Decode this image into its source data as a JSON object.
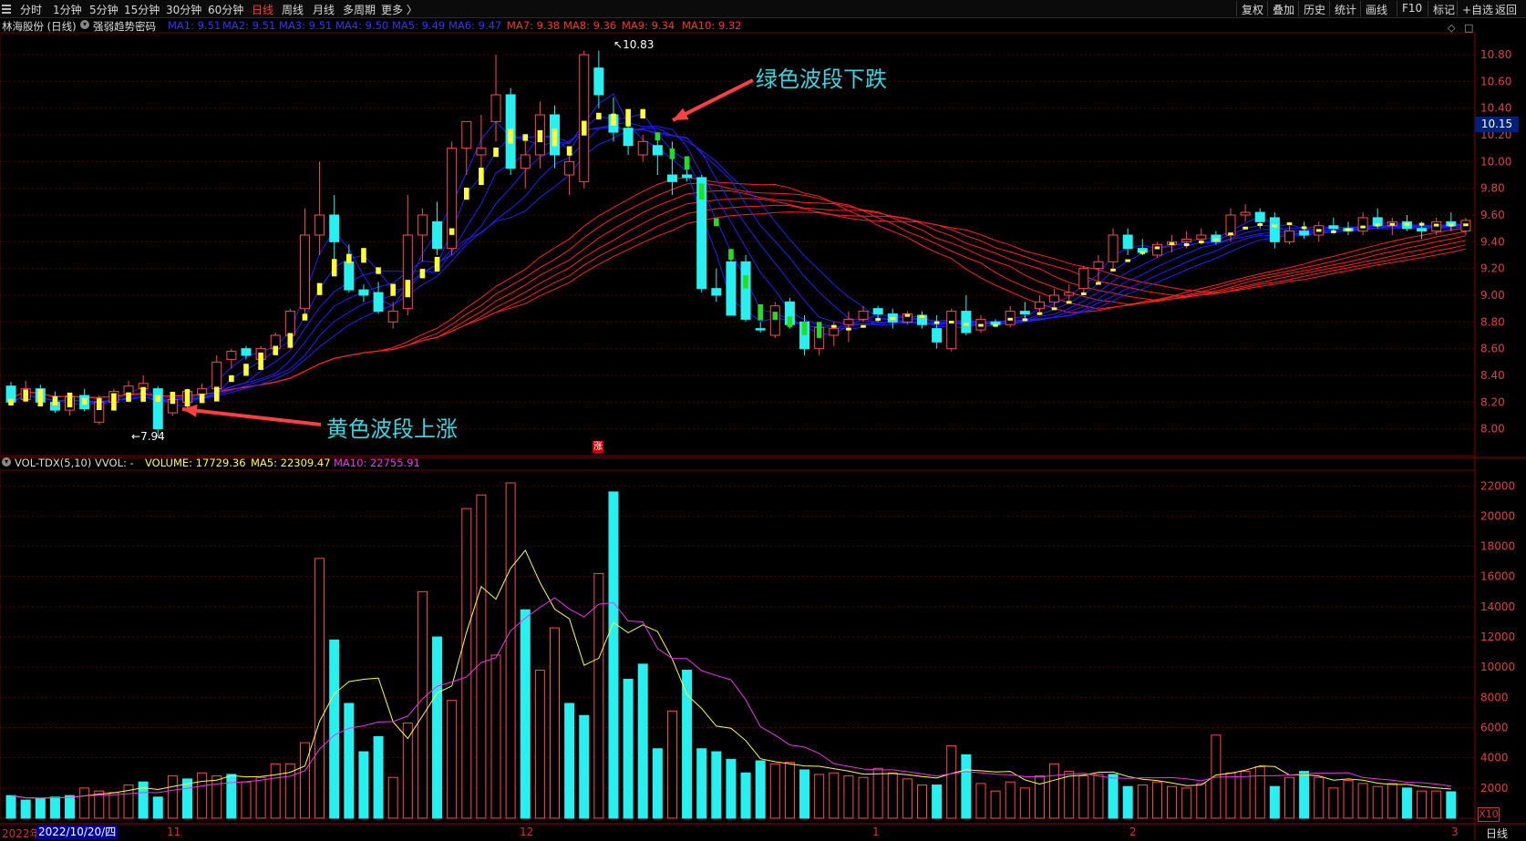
{
  "toolbar": {
    "timeframes": [
      "分时",
      "1分钟",
      "5分钟",
      "15分钟",
      "30分钟",
      "60分钟",
      "日线",
      "周线",
      "月线",
      "多周期",
      "更多 〉"
    ],
    "active_index": 6,
    "right_buttons": [
      "复权",
      "叠加",
      "历史",
      "统计",
      "画线",
      "F10",
      "标记",
      "+自选",
      "返回"
    ]
  },
  "info": {
    "stock": "林海股份 (日线)",
    "indicator": "强弱趋势密码",
    "ma_short": [
      "MA1: 9.51",
      "MA2: 9.51",
      "MA3: 9.51",
      "MA4: 9.50",
      "MA5: 9.49",
      "MA6: 9.47"
    ],
    "ma_long": [
      "MA7: 9.38",
      "MA8: 9.36",
      "MA9: 9.34",
      "MA10: 9.32"
    ]
  },
  "volume_info": {
    "label": "VOL-TDX(5,10) VVOL: -",
    "volume": "VOLUME: 17729.36",
    "ma5": "MA5: 22309.47",
    "ma10": "MA10: 22755.91"
  },
  "annotations": {
    "green_wave": "绿色波段下跌",
    "yellow_wave": "黄色波段上涨",
    "high_tag": "10.83",
    "low_tag": "7.94",
    "current_price": "10.15",
    "zhang_badge": "涨"
  },
  "xaxis": {
    "year": "2022年",
    "date_box": "2022/10/20/四",
    "months": [
      "11",
      "12",
      "1",
      "2",
      "3"
    ],
    "period_label": "日线",
    "x10": "X10"
  },
  "colors": {
    "up_candle": "#ff4a4a",
    "down_candle": "#29f0f0",
    "yellow_signal": "#ffff33",
    "green_signal": "#22dd22",
    "short_ma": "#2020ff",
    "long_ma": "#ff2020",
    "vol_ma5": "#ffff33",
    "vol_ma10": "#ee33ee"
  },
  "chart_data": [
    {
      "type": "candlestick",
      "title": "林海股份 (日线)",
      "ylim": [
        7.8,
        10.95
      ],
      "yticks": [
        8.0,
        8.2,
        8.4,
        8.6,
        8.8,
        9.0,
        9.2,
        9.4,
        9.6,
        9.8,
        10.0,
        10.2,
        10.4,
        10.6,
        10.8
      ],
      "ohlc": [
        [
          8.32,
          8.35,
          8.18,
          8.2
        ],
        [
          8.22,
          8.36,
          8.2,
          8.3
        ],
        [
          8.3,
          8.33,
          8.18,
          8.2
        ],
        [
          8.2,
          8.28,
          8.12,
          8.14
        ],
        [
          8.14,
          8.26,
          8.1,
          8.24
        ],
        [
          8.25,
          8.3,
          8.13,
          8.15
        ],
        [
          8.05,
          8.25,
          8.03,
          8.2
        ],
        [
          8.2,
          8.3,
          8.16,
          8.28
        ],
        [
          8.26,
          8.36,
          8.2,
          8.32
        ],
        [
          8.3,
          8.4,
          8.24,
          8.34
        ],
        [
          8.3,
          8.32,
          7.94,
          8.0
        ],
        [
          8.12,
          8.24,
          8.1,
          8.22
        ],
        [
          8.2,
          8.3,
          8.15,
          8.28
        ],
        [
          8.26,
          8.34,
          8.2,
          8.3
        ],
        [
          8.3,
          8.55,
          8.25,
          8.5
        ],
        [
          8.52,
          8.6,
          8.45,
          8.58
        ],
        [
          8.6,
          8.62,
          8.52,
          8.55
        ],
        [
          8.52,
          8.62,
          8.45,
          8.6
        ],
        [
          8.6,
          8.72,
          8.58,
          8.7
        ],
        [
          8.7,
          8.9,
          8.6,
          8.88
        ],
        [
          8.9,
          9.65,
          8.85,
          9.45
        ],
        [
          9.45,
          10.0,
          9.3,
          9.6
        ],
        [
          9.6,
          9.75,
          9.2,
          9.4
        ],
        [
          9.25,
          9.38,
          9.02,
          9.04
        ],
        [
          9.04,
          9.08,
          8.95,
          9.0
        ],
        [
          9.02,
          9.1,
          8.86,
          8.88
        ],
        [
          8.8,
          8.95,
          8.75,
          8.88
        ],
        [
          8.9,
          9.75,
          8.85,
          9.45
        ],
        [
          9.45,
          9.65,
          9.25,
          9.6
        ],
        [
          9.55,
          9.7,
          9.3,
          9.35
        ],
        [
          9.35,
          10.15,
          9.3,
          10.1
        ],
        [
          10.1,
          10.25,
          9.9,
          10.3
        ],
        [
          10.05,
          10.35,
          9.95,
          10.1
        ],
        [
          10.3,
          10.8,
          10.15,
          10.5
        ],
        [
          10.5,
          10.55,
          9.9,
          9.95
        ],
        [
          9.95,
          10.2,
          9.8,
          10.05
        ],
        [
          10.05,
          10.45,
          9.95,
          10.35
        ],
        [
          10.35,
          10.42,
          9.95,
          10.05
        ],
        [
          9.9,
          10.05,
          9.75,
          10.0
        ],
        [
          9.85,
          10.83,
          9.8,
          10.8
        ],
        [
          10.7,
          10.83,
          10.4,
          10.5
        ],
        [
          10.35,
          10.48,
          10.15,
          10.22
        ],
        [
          10.25,
          10.38,
          10.05,
          10.12
        ],
        [
          10.05,
          10.2,
          10.0,
          10.15
        ],
        [
          10.12,
          10.2,
          9.9,
          10.05
        ],
        [
          9.9,
          10.15,
          9.75,
          9.85
        ],
        [
          9.9,
          9.95,
          9.85,
          9.88
        ],
        [
          9.88,
          9.9,
          9.02,
          9.05
        ],
        [
          9.05,
          9.2,
          8.95,
          9.0
        ],
        [
          9.25,
          9.28,
          8.85,
          8.85
        ],
        [
          9.25,
          9.3,
          8.8,
          8.82
        ],
        [
          8.75,
          8.8,
          8.72,
          8.74
        ],
        [
          8.7,
          8.95,
          8.68,
          8.92
        ],
        [
          8.95,
          8.98,
          8.75,
          8.78
        ],
        [
          8.8,
          8.85,
          8.55,
          8.6
        ],
        [
          8.6,
          8.8,
          8.55,
          8.76
        ],
        [
          8.7,
          8.8,
          8.62,
          8.75
        ],
        [
          8.78,
          8.88,
          8.65,
          8.82
        ],
        [
          8.82,
          8.92,
          8.8,
          8.88
        ],
        [
          8.9,
          8.92,
          8.8,
          8.86
        ],
        [
          8.86,
          8.9,
          8.75,
          8.8
        ],
        [
          8.8,
          8.88,
          8.78,
          8.86
        ],
        [
          8.85,
          8.88,
          8.75,
          8.78
        ],
        [
          8.75,
          8.85,
          8.6,
          8.65
        ],
        [
          8.6,
          8.9,
          8.58,
          8.88
        ],
        [
          8.88,
          9.0,
          8.7,
          8.72
        ],
        [
          8.74,
          8.85,
          8.72,
          8.82
        ],
        [
          8.8,
          8.82,
          8.76,
          8.78
        ],
        [
          8.78,
          8.92,
          8.76,
          8.88
        ],
        [
          8.88,
          8.95,
          8.82,
          8.86
        ],
        [
          8.9,
          9.0,
          8.85,
          8.95
        ],
        [
          8.95,
          9.05,
          8.9,
          9.0
        ],
        [
          9.0,
          9.08,
          8.95,
          9.02
        ],
        [
          9.05,
          9.22,
          9.0,
          9.2
        ],
        [
          9.2,
          9.3,
          9.1,
          9.25
        ],
        [
          9.25,
          9.5,
          9.2,
          9.45
        ],
        [
          9.45,
          9.5,
          9.3,
          9.35
        ],
        [
          9.35,
          9.42,
          9.3,
          9.32
        ],
        [
          9.3,
          9.4,
          9.28,
          9.38
        ],
        [
          9.38,
          9.45,
          9.32,
          9.4
        ],
        [
          9.4,
          9.48,
          9.35,
          9.42
        ],
        [
          9.42,
          9.5,
          9.38,
          9.45
        ],
        [
          9.45,
          9.48,
          9.38,
          9.4
        ],
        [
          9.45,
          9.65,
          9.4,
          9.6
        ],
        [
          9.6,
          9.68,
          9.55,
          9.62
        ],
        [
          9.62,
          9.65,
          9.5,
          9.55
        ],
        [
          9.58,
          9.62,
          9.35,
          9.4
        ],
        [
          9.4,
          9.52,
          9.38,
          9.48
        ],
        [
          9.48,
          9.55,
          9.42,
          9.45
        ],
        [
          9.45,
          9.55,
          9.4,
          9.52
        ],
        [
          9.52,
          9.58,
          9.46,
          9.5
        ],
        [
          9.5,
          9.55,
          9.45,
          9.48
        ],
        [
          9.48,
          9.62,
          9.45,
          9.58
        ],
        [
          9.58,
          9.65,
          9.5,
          9.52
        ],
        [
          9.52,
          9.58,
          9.45,
          9.55
        ],
        [
          9.55,
          9.6,
          9.48,
          9.5
        ],
        [
          9.5,
          9.55,
          9.42,
          9.48
        ],
        [
          9.48,
          9.58,
          9.45,
          9.55
        ],
        [
          9.55,
          9.62,
          9.48,
          9.52
        ],
        [
          9.48,
          9.58,
          9.45,
          9.56
        ]
      ],
      "series": [
        {
          "name": "MA1",
          "label": "MA1: 9.51"
        },
        {
          "name": "MA2",
          "label": "MA2: 9.51"
        },
        {
          "name": "MA3",
          "label": "MA3: 9.51"
        },
        {
          "name": "MA4",
          "label": "MA4: 9.50"
        },
        {
          "name": "MA5",
          "label": "MA5: 9.49"
        },
        {
          "name": "MA6",
          "label": "MA6: 9.47"
        },
        {
          "name": "MA7",
          "label": "MA7: 9.38"
        },
        {
          "name": "MA8",
          "label": "MA8: 9.36"
        },
        {
          "name": "MA9",
          "label": "MA9: 9.34"
        },
        {
          "name": "MA10",
          "label": "MA10: 9.32"
        }
      ],
      "signal_up_range": [
        0,
        44
      ],
      "signal_down_range": [
        44,
        56
      ],
      "grid": true
    },
    {
      "type": "bar",
      "title": "VOL-TDX(5,10)",
      "ylim": [
        0,
        22800
      ],
      "yticks": [
        2000,
        4000,
        6000,
        8000,
        10000,
        12000,
        14000,
        16000,
        18000,
        20000,
        22000
      ],
      "volumes": [
        1500,
        1200,
        1300,
        1400,
        1500,
        2000,
        1800,
        1700,
        2200,
        2400,
        1400,
        2800,
        2600,
        3000,
        2800,
        2900,
        2400,
        2700,
        3600,
        3600,
        5000,
        17200,
        11800,
        7600,
        4400,
        5400,
        2700,
        6300,
        15000,
        12000,
        7800,
        20500,
        21400,
        10800,
        22200,
        13800,
        9800,
        12600,
        7600,
        6800,
        16200,
        21600,
        9200,
        10200,
        4600,
        7100,
        9800,
        4600,
        4400,
        3900,
        3000,
        3800,
        3600,
        3700,
        3200,
        2900,
        3000,
        2800,
        2700,
        3300,
        3000,
        2600,
        2200,
        2200,
        4800,
        4200,
        2300,
        1800,
        2400,
        2000,
        2800,
        3600,
        3100,
        2800,
        2900,
        2900,
        2100,
        2200,
        2400,
        2100,
        2000,
        2300,
        5500,
        3000,
        3100,
        3400,
        2100,
        2700,
        3100,
        2700,
        2000,
        2500,
        2300,
        2100,
        2300,
        2000,
        1800,
        1800,
        1750
      ],
      "bar_colors": [
        "c",
        "c",
        "c",
        "c",
        "c",
        "r",
        "r",
        "r",
        "r",
        "c",
        "c",
        "r",
        "c",
        "r",
        "r",
        "c",
        "r",
        "r",
        "r",
        "r",
        "r",
        "r",
        "c",
        "c",
        "c",
        "c",
        "r",
        "r",
        "r",
        "c",
        "r",
        "r",
        "r",
        "r",
        "r",
        "c",
        "r",
        "r",
        "c",
        "c",
        "r",
        "c",
        "c",
        "c",
        "c",
        "r",
        "c",
        "c",
        "c",
        "c",
        "c",
        "c",
        "r",
        "r",
        "c",
        "r",
        "r",
        "r",
        "r",
        "r",
        "r",
        "r",
        "r",
        "c",
        "r",
        "c",
        "r",
        "r",
        "r",
        "r",
        "r",
        "r",
        "r",
        "r",
        "r",
        "c",
        "c",
        "r",
        "r",
        "r",
        "r",
        "r",
        "r",
        "r",
        "r",
        "r",
        "c",
        "r",
        "c",
        "r",
        "r",
        "r",
        "r",
        "r",
        "r",
        "c",
        "r",
        "r",
        "c"
      ],
      "series": [
        {
          "name": "MA5",
          "label": "MA5: 22309.47"
        },
        {
          "name": "MA10",
          "label": "MA10: 22755.91"
        }
      ]
    }
  ]
}
